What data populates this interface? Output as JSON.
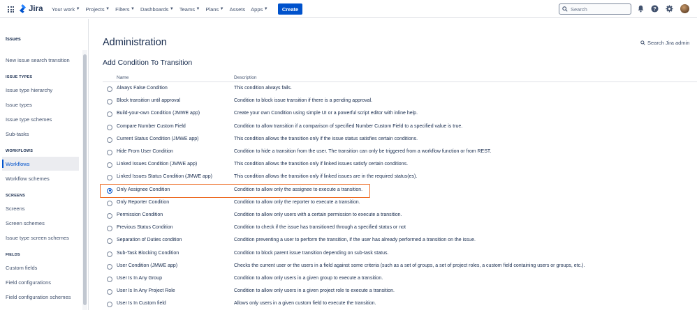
{
  "topnav": {
    "logo_text": "Jira",
    "menu": [
      {
        "label": "Your work"
      },
      {
        "label": "Projects"
      },
      {
        "label": "Filters"
      },
      {
        "label": "Dashboards"
      },
      {
        "label": "Teams"
      },
      {
        "label": "Plans"
      },
      {
        "label": "Assets"
      },
      {
        "label": "Apps"
      }
    ],
    "create_label": "Create",
    "search_placeholder": "Search",
    "brand_color": "#0052cc"
  },
  "sidebar": {
    "header": "Issues",
    "top_item": "New issue search transition",
    "sections": [
      {
        "title": "ISSUE TYPES",
        "items": [
          "Issue type hierarchy",
          "Issue types",
          "Issue type schemes",
          "Sub-tasks"
        ]
      },
      {
        "title": "WORKFLOWS",
        "items": [
          "Workflows",
          "Workflow schemes"
        ]
      },
      {
        "title": "SCREENS",
        "items": [
          "Screens",
          "Screen schemes",
          "Issue type screen schemes"
        ]
      },
      {
        "title": "FIELDS",
        "items": [
          "Custom fields",
          "Field configurations",
          "Field configuration schemes"
        ]
      }
    ],
    "active_item": "Workflows"
  },
  "main": {
    "title": "Administration",
    "admin_search": "Search Jira admin",
    "section_title": "Add Condition To Transition",
    "columns": {
      "name": "Name",
      "description": "Description"
    },
    "selected": "Only Assignee Condition",
    "highlight_color": "#ed6b23",
    "rows": [
      {
        "name": "Always False Condition",
        "description": "This condition always fails."
      },
      {
        "name": "Block transition until approval",
        "description": "Condition to block issue transition if there is a pending approval."
      },
      {
        "name": "Build-your-own Condition (JMWE app)",
        "description": "Create your own Condition using simple UI or a powerful script editor with inline help."
      },
      {
        "name": "Compare Number Custom Field",
        "description": "Condition to allow transition if a comparison of specified Number Custom Field to a specified value is true."
      },
      {
        "name": "Current Status Condition (JMWE app)",
        "description": "This condition allows the transition only if the issue status satisfies certain conditions."
      },
      {
        "name": "Hide From User Condition",
        "description": "Condition to hide a transition from the user. The transition can only be triggered from a workflow function or from REST."
      },
      {
        "name": "Linked Issues Condition (JMWE app)",
        "description": "This condition allows the transition only if linked issues satisfy certain conditions."
      },
      {
        "name": "Linked Issues Status Condition (JMWE app)",
        "description": "This condition allows the transition only if linked issues are in the required status(es)."
      },
      {
        "name": "Only Assignee Condition",
        "description": "Condition to allow only the assignee to execute a transition."
      },
      {
        "name": "Only Reporter Condition",
        "description": "Condition to allow only the reporter to execute a transition."
      },
      {
        "name": "Permission Condition",
        "description": "Condition to allow only users with a certain permission to execute a transition."
      },
      {
        "name": "Previous Status Condition",
        "description": "Condition to check if the issue has transitioned through a specified status or not"
      },
      {
        "name": "Separation of Duties condition",
        "description": "Condition preventing a user to perform the transition, if the user has already performed a transition on the issue."
      },
      {
        "name": "Sub-Task Blocking Condition",
        "description": "Condition to block parent issue transition depending on sub-task status."
      },
      {
        "name": "User Condition (JMWE app)",
        "description": "Checks the current user or the users in a field against some criteria (such as a set of groups, a set of project roles, a custom field containing users or groups, etc.)."
      },
      {
        "name": "User Is In Any Group",
        "description": "Condition to allow only users in a given group to execute a transition."
      },
      {
        "name": "User Is In Any Project Role",
        "description": "Condition to allow only users in a given project role to execute a transition."
      },
      {
        "name": "User Is In Custom field",
        "description": "Allows only users in a given custom field to execute the transition."
      }
    ]
  }
}
